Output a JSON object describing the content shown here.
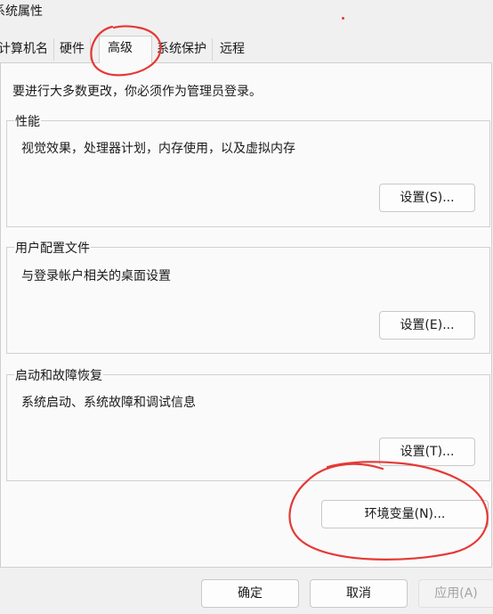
{
  "window": {
    "title": "系统属性"
  },
  "tabs": [
    {
      "label": "计算机名"
    },
    {
      "label": "硬件"
    },
    {
      "label": "高级"
    },
    {
      "label": "系统保护"
    },
    {
      "label": "远程"
    }
  ],
  "notice": "要进行大多数更改，你必须作为管理员登录。",
  "groups": {
    "performance": {
      "title": "性能",
      "description": "视觉效果，处理器计划，内存使用，以及虚拟内存",
      "button": "设置(S)..."
    },
    "user_profiles": {
      "title": "用户配置文件",
      "description": "与登录帐户相关的桌面设置",
      "button": "设置(E)..."
    },
    "startup_recovery": {
      "title": "启动和故障恢复",
      "description": "系统启动、系统故障和调试信息",
      "button": "设置(T)..."
    }
  },
  "env_button": "环境变量(N)...",
  "footer": {
    "ok": "确定",
    "cancel": "取消",
    "apply": "应用(A)"
  },
  "annotation_color": "#e53935"
}
